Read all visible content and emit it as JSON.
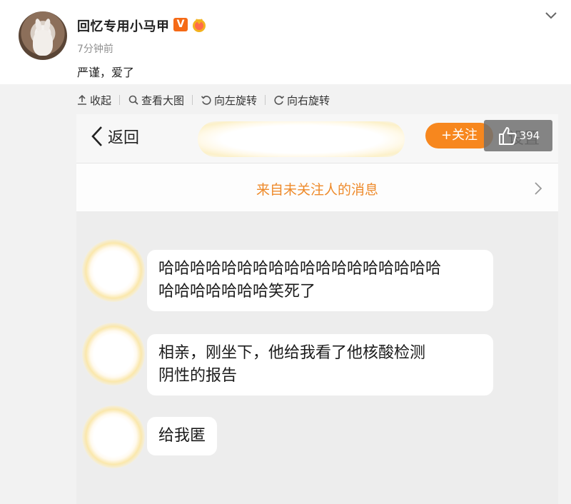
{
  "post": {
    "username": "回忆专用小马甲",
    "vip_badge": "V",
    "timestamp": "7分钟前",
    "text": "严谨，爱了"
  },
  "toolbar": {
    "collapse": "收起",
    "view_large": "查看大图",
    "rotate_left": "向左旋转",
    "rotate_right": "向右旋转"
  },
  "screenshot": {
    "back_label": "返回",
    "follow_label": "+关注",
    "settings_label": "设置",
    "like_count": "394",
    "notice": "来自未关注人的消息",
    "messages": [
      {
        "line1": "哈哈哈哈哈哈哈哈哈哈哈哈哈哈哈哈哈哈",
        "line2": "哈哈哈哈哈哈哈笑死了"
      },
      {
        "line1": "相亲，刚坐下，他给我看了他核酸检测",
        "line2": "阴性的报告"
      },
      {
        "line1": "给我匿",
        "line2": ""
      }
    ]
  },
  "colors": {
    "accent_orange": "#f7871e",
    "notice_orange": "#ee8a2a",
    "vip_orange": "#f56a16",
    "background_gray": "#f2f2f2"
  },
  "icons": [
    "chevron-down-icon",
    "collapse-icon",
    "magnifier-icon",
    "rotate-left-icon",
    "rotate-right-icon",
    "back-arrow-icon",
    "thumbs-up-icon",
    "chevron-right-icon",
    "medal-icon"
  ]
}
